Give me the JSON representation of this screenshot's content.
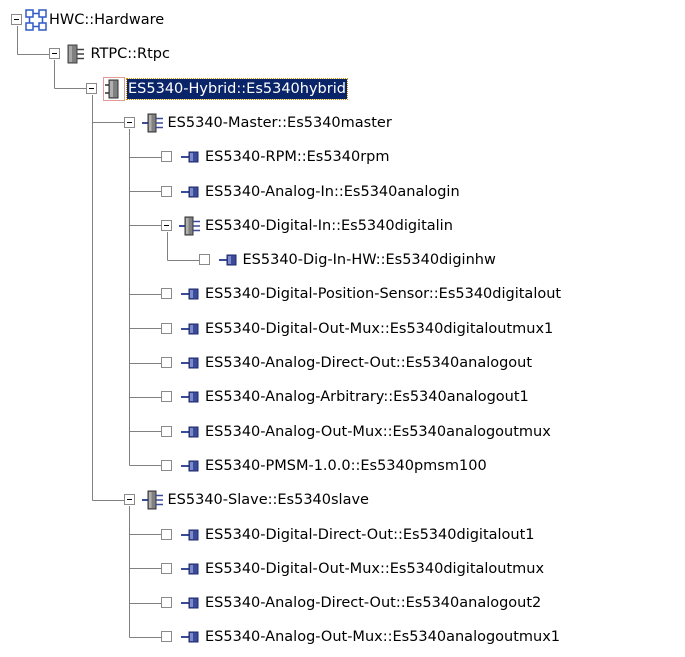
{
  "tree": {
    "colors": {
      "connector": "#808080",
      "selection_bg": "#0a246a",
      "selection_fg": "#ffffff",
      "icon_fill": "#6b6b6b",
      "icon_body": "#808080",
      "icon_accent": "#3b4a9a",
      "hub_blue": "#2f59c8"
    },
    "nodes": [
      {
        "id": "n0",
        "level": 0,
        "label": "HWC::Hardware",
        "icon": "hardware-network-icon",
        "expander": "expanded",
        "selected": false,
        "last": true
      },
      {
        "id": "n1",
        "level": 1,
        "label": "RTPC::Rtpc",
        "icon": "rtpc-module-icon",
        "expander": "expanded",
        "selected": false,
        "last": true
      },
      {
        "id": "n2",
        "level": 2,
        "label": "ES5340-Hybrid::Es5340hybrid",
        "icon": "board-icon",
        "expander": "expanded",
        "selected": true,
        "last": true
      },
      {
        "id": "n3",
        "level": 3,
        "label": "ES5340-Master::Es5340master",
        "icon": "submodule-icon",
        "expander": "expanded",
        "selected": false,
        "last": false
      },
      {
        "id": "n4",
        "level": 4,
        "label": "ES5340-RPM::Es5340rpm",
        "icon": "channel-icon",
        "expander": "empty",
        "selected": false,
        "last": false
      },
      {
        "id": "n5",
        "level": 4,
        "label": "ES5340-Analog-In::Es5340analogin",
        "icon": "channel-icon",
        "expander": "empty",
        "selected": false,
        "last": false
      },
      {
        "id": "n6",
        "level": 4,
        "label": "ES5340-Digital-In::Es5340digitalin",
        "icon": "submodule-icon",
        "expander": "expanded",
        "selected": false,
        "last": false
      },
      {
        "id": "n7",
        "level": 5,
        "label": "ES5340-Dig-In-HW::Es5340diginhw",
        "icon": "channel-icon",
        "expander": "empty",
        "selected": false,
        "last": true
      },
      {
        "id": "n8",
        "level": 4,
        "label": "ES5340-Digital-Position-Sensor::Es5340digitalout",
        "icon": "channel-icon",
        "expander": "empty",
        "selected": false,
        "last": false
      },
      {
        "id": "n9",
        "level": 4,
        "label": "ES5340-Digital-Out-Mux::Es5340digitaloutmux1",
        "icon": "channel-icon",
        "expander": "empty",
        "selected": false,
        "last": false
      },
      {
        "id": "n10",
        "level": 4,
        "label": "ES5340-Analog-Direct-Out::Es5340analogout",
        "icon": "channel-icon",
        "expander": "empty",
        "selected": false,
        "last": false
      },
      {
        "id": "n11",
        "level": 4,
        "label": "ES5340-Analog-Arbitrary::Es5340analogout1",
        "icon": "channel-icon",
        "expander": "empty",
        "selected": false,
        "last": false
      },
      {
        "id": "n12",
        "level": 4,
        "label": "ES5340-Analog-Out-Mux::Es5340analogoutmux",
        "icon": "channel-icon",
        "expander": "empty",
        "selected": false,
        "last": false
      },
      {
        "id": "n13",
        "level": 4,
        "label": "ES5340-PMSM-1.0.0::Es5340pmsm100",
        "icon": "channel-icon",
        "expander": "empty",
        "selected": false,
        "last": true
      },
      {
        "id": "n14",
        "level": 3,
        "label": "ES5340-Slave::Es5340slave",
        "icon": "submodule-icon",
        "expander": "expanded",
        "selected": false,
        "last": true
      },
      {
        "id": "n15",
        "level": 4,
        "label": "ES5340-Digital-Direct-Out::Es5340digitalout1",
        "icon": "channel-icon",
        "expander": "empty",
        "selected": false,
        "last": false
      },
      {
        "id": "n16",
        "level": 4,
        "label": "ES5340-Digital-Out-Mux::Es5340digitaloutmux",
        "icon": "channel-icon",
        "expander": "empty",
        "selected": false,
        "last": false
      },
      {
        "id": "n17",
        "level": 4,
        "label": "ES5340-Analog-Direct-Out::Es5340analogout2",
        "icon": "channel-icon",
        "expander": "empty",
        "selected": false,
        "last": false
      },
      {
        "id": "n18",
        "level": 4,
        "label": "ES5340-Analog-Out-Mux::Es5340analogoutmux1",
        "icon": "channel-icon",
        "expander": "empty",
        "selected": false,
        "last": true
      }
    ]
  }
}
